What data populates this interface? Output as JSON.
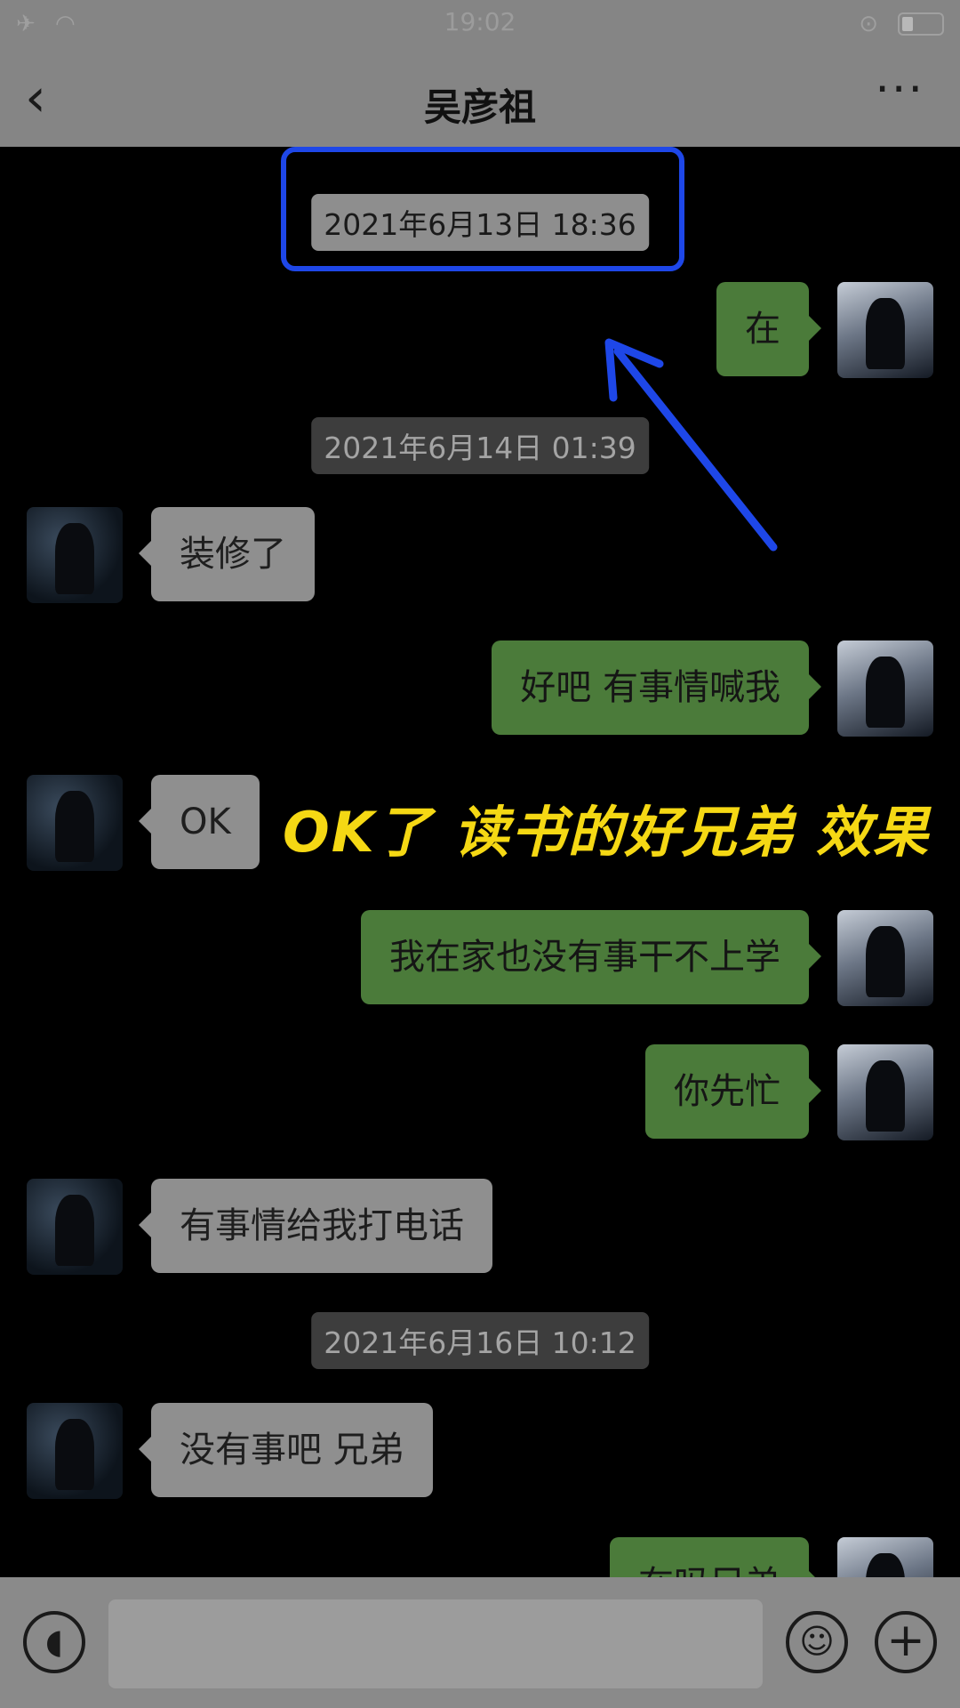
{
  "status_bar": {
    "time": "19:02"
  },
  "nav": {
    "back_icon": "‹",
    "title": "吴彦祖",
    "more_icon": "···"
  },
  "chat": {
    "timestamps": [
      "2021年6月13日 18:36",
      "2021年6月14日 01:39",
      "2021年6月16日 10:12"
    ],
    "messages": [
      {
        "side": "right",
        "text": "在"
      },
      {
        "side": "left",
        "text": "装修了"
      },
      {
        "side": "right",
        "text": "好吧 有事情喊我"
      },
      {
        "side": "left",
        "text": "OK"
      },
      {
        "side": "right",
        "text": "我在家也没有事干不上学"
      },
      {
        "side": "right",
        "text": "你先忙"
      },
      {
        "side": "left",
        "text": "有事情给我打电话"
      },
      {
        "side": "left",
        "text": "没有事吧 兄弟"
      },
      {
        "side": "right",
        "text": "在吗兄弟"
      }
    ]
  },
  "overlay": {
    "caption": "OK了 读书的好兄弟 效果",
    "highlight_color": "#1e47e8",
    "caption_color": "#f5d814"
  },
  "input_bar": {
    "voice_icon": "voice-icon",
    "emoji_icon": "emoji-icon",
    "plus_icon": "plus-icon"
  }
}
